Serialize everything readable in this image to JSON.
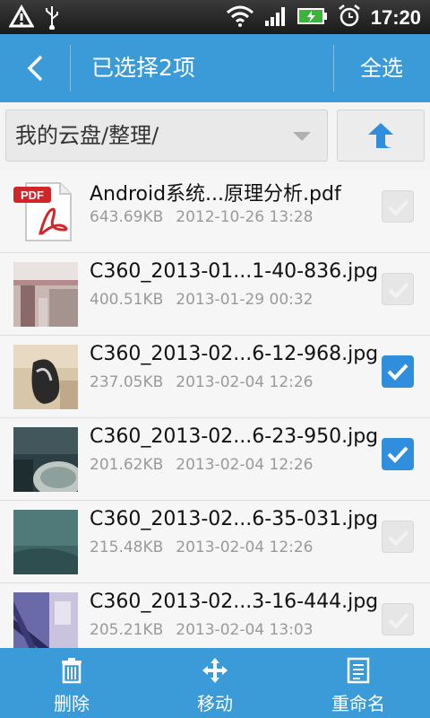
{
  "status_bar": {
    "time": "17:20",
    "icons": [
      "warning-icon",
      "usb-icon",
      "wifi-icon",
      "signal-icon",
      "battery-charging-icon",
      "alarm-icon"
    ]
  },
  "header": {
    "title": "已选择2项",
    "select_all": "全选"
  },
  "path_bar": {
    "path": "我的云盘/整理/"
  },
  "files": [
    {
      "name": "Android系统...原理分析.pdf",
      "size": "643.69KB",
      "date": "2012-10-26 13:28",
      "checked": false,
      "thumb": "pdf-icon"
    },
    {
      "name": "C360_2013-01...1-40-836.jpg",
      "size": "400.51KB",
      "date": "2013-01-29 00:32",
      "checked": false,
      "thumb": "photo"
    },
    {
      "name": "C360_2013-02...6-12-968.jpg",
      "size": "237.05KB",
      "date": "2013-02-04 12:26",
      "checked": true,
      "thumb": "photo"
    },
    {
      "name": "C360_2013-02...6-23-950.jpg",
      "size": "201.62KB",
      "date": "2013-02-04 12:26",
      "checked": true,
      "thumb": "photo"
    },
    {
      "name": "C360_2013-02...6-35-031.jpg",
      "size": "215.48KB",
      "date": "2013-02-04 12:26",
      "checked": false,
      "thumb": "photo"
    },
    {
      "name": "C360_2013-02...3-16-444.jpg",
      "size": "205.21KB",
      "date": "2013-02-04 13:03",
      "checked": false,
      "thumb": "photo"
    }
  ],
  "toolbar": {
    "delete_label": "删除",
    "move_label": "移动",
    "rename_label": "重命名"
  },
  "colors": {
    "accent": "#3a9bd8",
    "checkbox_on": "#2f8fdd"
  }
}
